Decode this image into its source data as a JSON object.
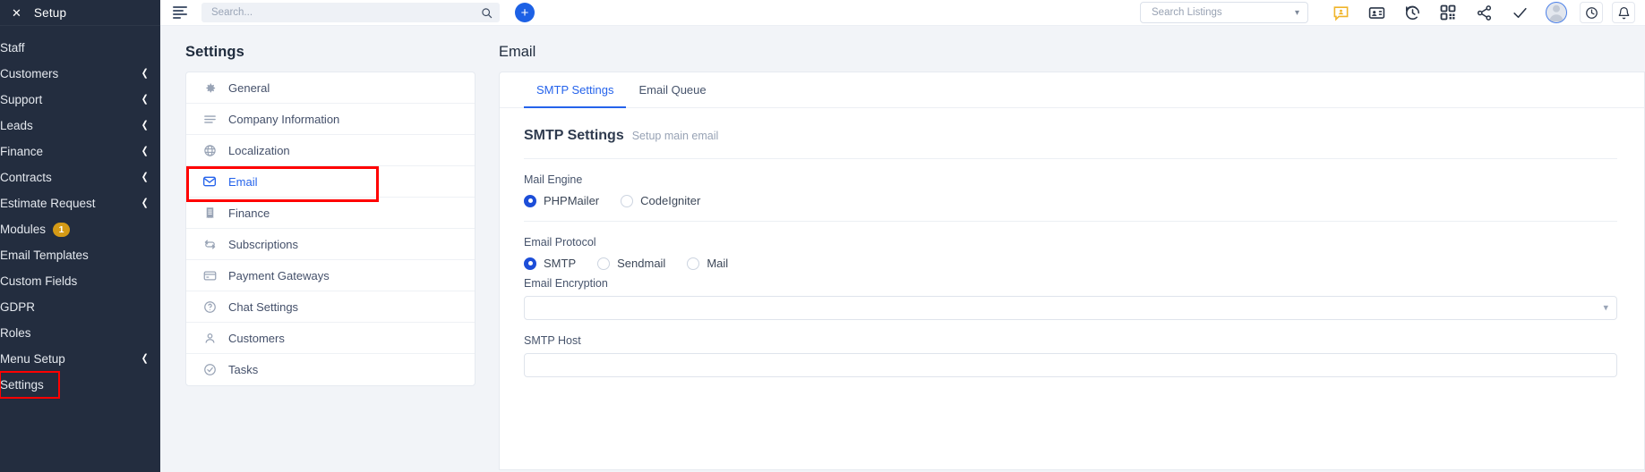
{
  "sidebar": {
    "close_icon": "close-icon",
    "title": "Setup",
    "items": [
      {
        "label": "Staff",
        "chevron": false,
        "badge": null,
        "highlighted": false
      },
      {
        "label": "Customers",
        "chevron": true,
        "badge": null,
        "highlighted": false
      },
      {
        "label": "Support",
        "chevron": true,
        "badge": null,
        "highlighted": false
      },
      {
        "label": "Leads",
        "chevron": true,
        "badge": null,
        "highlighted": false
      },
      {
        "label": "Finance",
        "chevron": true,
        "badge": null,
        "highlighted": false
      },
      {
        "label": "Contracts",
        "chevron": true,
        "badge": null,
        "highlighted": false
      },
      {
        "label": "Estimate Request",
        "chevron": true,
        "badge": null,
        "highlighted": false
      },
      {
        "label": "Modules",
        "chevron": false,
        "badge": "1",
        "highlighted": false
      },
      {
        "label": "Email Templates",
        "chevron": false,
        "badge": null,
        "highlighted": false
      },
      {
        "label": "Custom Fields",
        "chevron": false,
        "badge": null,
        "highlighted": false
      },
      {
        "label": "GDPR",
        "chevron": false,
        "badge": null,
        "highlighted": false
      },
      {
        "label": "Roles",
        "chevron": false,
        "badge": null,
        "highlighted": false
      },
      {
        "label": "Menu Setup",
        "chevron": true,
        "badge": null,
        "highlighted": false
      },
      {
        "label": "Settings",
        "chevron": false,
        "badge": null,
        "highlighted": true
      }
    ]
  },
  "topbar": {
    "menu_icon": "hamburger-menu-icon",
    "search": {
      "value": "",
      "placeholder": "Search..."
    },
    "search_icon": "search-icon",
    "add_button_label": "+",
    "listings_select": {
      "value": "Search Listings"
    },
    "icons": [
      "chat-feedback-icon",
      "contact-card-icon",
      "history-clock-icon",
      "qr-code-icon",
      "share-icon",
      "checkmark-icon"
    ],
    "avatar": "user-avatar",
    "clock_icon": "clock-icon",
    "bell_icon": "bell-icon"
  },
  "settings_panel": {
    "heading": "Settings",
    "items": [
      {
        "label": "General",
        "icon": "gear-icon",
        "active": false
      },
      {
        "label": "Company Information",
        "icon": "list-icon",
        "active": false
      },
      {
        "label": "Localization",
        "icon": "globe-icon",
        "active": false
      },
      {
        "label": "Email",
        "icon": "envelope-icon",
        "active": true
      },
      {
        "label": "Finance",
        "icon": "receipt-icon",
        "active": false
      },
      {
        "label": "Subscriptions",
        "icon": "refresh-icon",
        "active": false
      },
      {
        "label": "Payment Gateways",
        "icon": "credit-card-icon",
        "active": false
      },
      {
        "label": "Chat Settings",
        "icon": "question-icon",
        "active": false
      },
      {
        "label": "Customers",
        "icon": "user-icon",
        "active": false
      },
      {
        "label": "Tasks",
        "icon": "check-circle-icon",
        "active": false
      }
    ]
  },
  "email_panel": {
    "heading": "Email",
    "tabs": [
      {
        "label": "SMTP Settings",
        "active": true
      },
      {
        "label": "Email Queue",
        "active": false
      }
    ],
    "form": {
      "title": "SMTP Settings",
      "subtitle": "Setup main email",
      "mail_engine": {
        "label": "Mail Engine",
        "options": [
          {
            "label": "PHPMailer",
            "selected": true
          },
          {
            "label": "CodeIgniter",
            "selected": false
          }
        ]
      },
      "email_protocol": {
        "label": "Email Protocol",
        "options": [
          {
            "label": "SMTP",
            "selected": true
          },
          {
            "label": "Sendmail",
            "selected": false
          },
          {
            "label": "Mail",
            "selected": false
          }
        ]
      },
      "email_encryption": {
        "label": "Email Encryption",
        "value": "",
        "caret": "chevron-down-icon"
      },
      "smtp_host": {
        "label": "SMTP Host",
        "value": ""
      }
    }
  },
  "colors": {
    "sidebar_bg": "#232d3f",
    "accent_blue": "#2563eb",
    "badge_orange": "#d49a16",
    "highlight_red": "#ff0000",
    "content_bg": "#f2f4f8"
  }
}
